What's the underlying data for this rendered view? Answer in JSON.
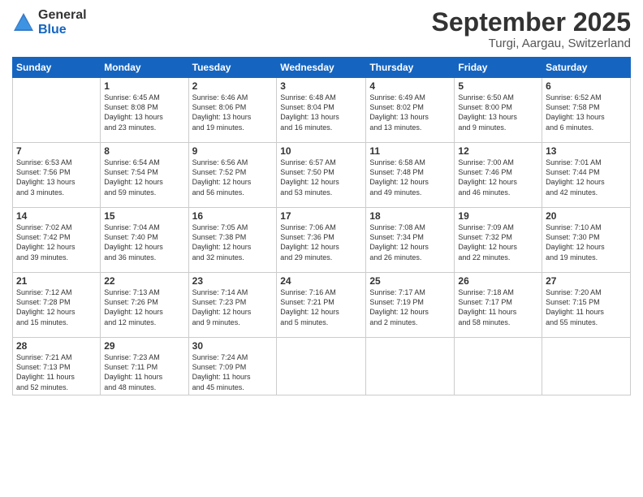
{
  "header": {
    "logo_general": "General",
    "logo_blue": "Blue",
    "month_title": "September 2025",
    "location": "Turgi, Aargau, Switzerland"
  },
  "weekdays": [
    "Sunday",
    "Monday",
    "Tuesday",
    "Wednesday",
    "Thursday",
    "Friday",
    "Saturday"
  ],
  "weeks": [
    [
      {
        "day": "",
        "content": ""
      },
      {
        "day": "1",
        "content": "Sunrise: 6:45 AM\nSunset: 8:08 PM\nDaylight: 13 hours\nand 23 minutes."
      },
      {
        "day": "2",
        "content": "Sunrise: 6:46 AM\nSunset: 8:06 PM\nDaylight: 13 hours\nand 19 minutes."
      },
      {
        "day": "3",
        "content": "Sunrise: 6:48 AM\nSunset: 8:04 PM\nDaylight: 13 hours\nand 16 minutes."
      },
      {
        "day": "4",
        "content": "Sunrise: 6:49 AM\nSunset: 8:02 PM\nDaylight: 13 hours\nand 13 minutes."
      },
      {
        "day": "5",
        "content": "Sunrise: 6:50 AM\nSunset: 8:00 PM\nDaylight: 13 hours\nand 9 minutes."
      },
      {
        "day": "6",
        "content": "Sunrise: 6:52 AM\nSunset: 7:58 PM\nDaylight: 13 hours\nand 6 minutes."
      }
    ],
    [
      {
        "day": "7",
        "content": "Sunrise: 6:53 AM\nSunset: 7:56 PM\nDaylight: 13 hours\nand 3 minutes."
      },
      {
        "day": "8",
        "content": "Sunrise: 6:54 AM\nSunset: 7:54 PM\nDaylight: 12 hours\nand 59 minutes."
      },
      {
        "day": "9",
        "content": "Sunrise: 6:56 AM\nSunset: 7:52 PM\nDaylight: 12 hours\nand 56 minutes."
      },
      {
        "day": "10",
        "content": "Sunrise: 6:57 AM\nSunset: 7:50 PM\nDaylight: 12 hours\nand 53 minutes."
      },
      {
        "day": "11",
        "content": "Sunrise: 6:58 AM\nSunset: 7:48 PM\nDaylight: 12 hours\nand 49 minutes."
      },
      {
        "day": "12",
        "content": "Sunrise: 7:00 AM\nSunset: 7:46 PM\nDaylight: 12 hours\nand 46 minutes."
      },
      {
        "day": "13",
        "content": "Sunrise: 7:01 AM\nSunset: 7:44 PM\nDaylight: 12 hours\nand 42 minutes."
      }
    ],
    [
      {
        "day": "14",
        "content": "Sunrise: 7:02 AM\nSunset: 7:42 PM\nDaylight: 12 hours\nand 39 minutes."
      },
      {
        "day": "15",
        "content": "Sunrise: 7:04 AM\nSunset: 7:40 PM\nDaylight: 12 hours\nand 36 minutes."
      },
      {
        "day": "16",
        "content": "Sunrise: 7:05 AM\nSunset: 7:38 PM\nDaylight: 12 hours\nand 32 minutes."
      },
      {
        "day": "17",
        "content": "Sunrise: 7:06 AM\nSunset: 7:36 PM\nDaylight: 12 hours\nand 29 minutes."
      },
      {
        "day": "18",
        "content": "Sunrise: 7:08 AM\nSunset: 7:34 PM\nDaylight: 12 hours\nand 26 minutes."
      },
      {
        "day": "19",
        "content": "Sunrise: 7:09 AM\nSunset: 7:32 PM\nDaylight: 12 hours\nand 22 minutes."
      },
      {
        "day": "20",
        "content": "Sunrise: 7:10 AM\nSunset: 7:30 PM\nDaylight: 12 hours\nand 19 minutes."
      }
    ],
    [
      {
        "day": "21",
        "content": "Sunrise: 7:12 AM\nSunset: 7:28 PM\nDaylight: 12 hours\nand 15 minutes."
      },
      {
        "day": "22",
        "content": "Sunrise: 7:13 AM\nSunset: 7:26 PM\nDaylight: 12 hours\nand 12 minutes."
      },
      {
        "day": "23",
        "content": "Sunrise: 7:14 AM\nSunset: 7:23 PM\nDaylight: 12 hours\nand 9 minutes."
      },
      {
        "day": "24",
        "content": "Sunrise: 7:16 AM\nSunset: 7:21 PM\nDaylight: 12 hours\nand 5 minutes."
      },
      {
        "day": "25",
        "content": "Sunrise: 7:17 AM\nSunset: 7:19 PM\nDaylight: 12 hours\nand 2 minutes."
      },
      {
        "day": "26",
        "content": "Sunrise: 7:18 AM\nSunset: 7:17 PM\nDaylight: 11 hours\nand 58 minutes."
      },
      {
        "day": "27",
        "content": "Sunrise: 7:20 AM\nSunset: 7:15 PM\nDaylight: 11 hours\nand 55 minutes."
      }
    ],
    [
      {
        "day": "28",
        "content": "Sunrise: 7:21 AM\nSunset: 7:13 PM\nDaylight: 11 hours\nand 52 minutes."
      },
      {
        "day": "29",
        "content": "Sunrise: 7:23 AM\nSunset: 7:11 PM\nDaylight: 11 hours\nand 48 minutes."
      },
      {
        "day": "30",
        "content": "Sunrise: 7:24 AM\nSunset: 7:09 PM\nDaylight: 11 hours\nand 45 minutes."
      },
      {
        "day": "",
        "content": ""
      },
      {
        "day": "",
        "content": ""
      },
      {
        "day": "",
        "content": ""
      },
      {
        "day": "",
        "content": ""
      }
    ]
  ]
}
